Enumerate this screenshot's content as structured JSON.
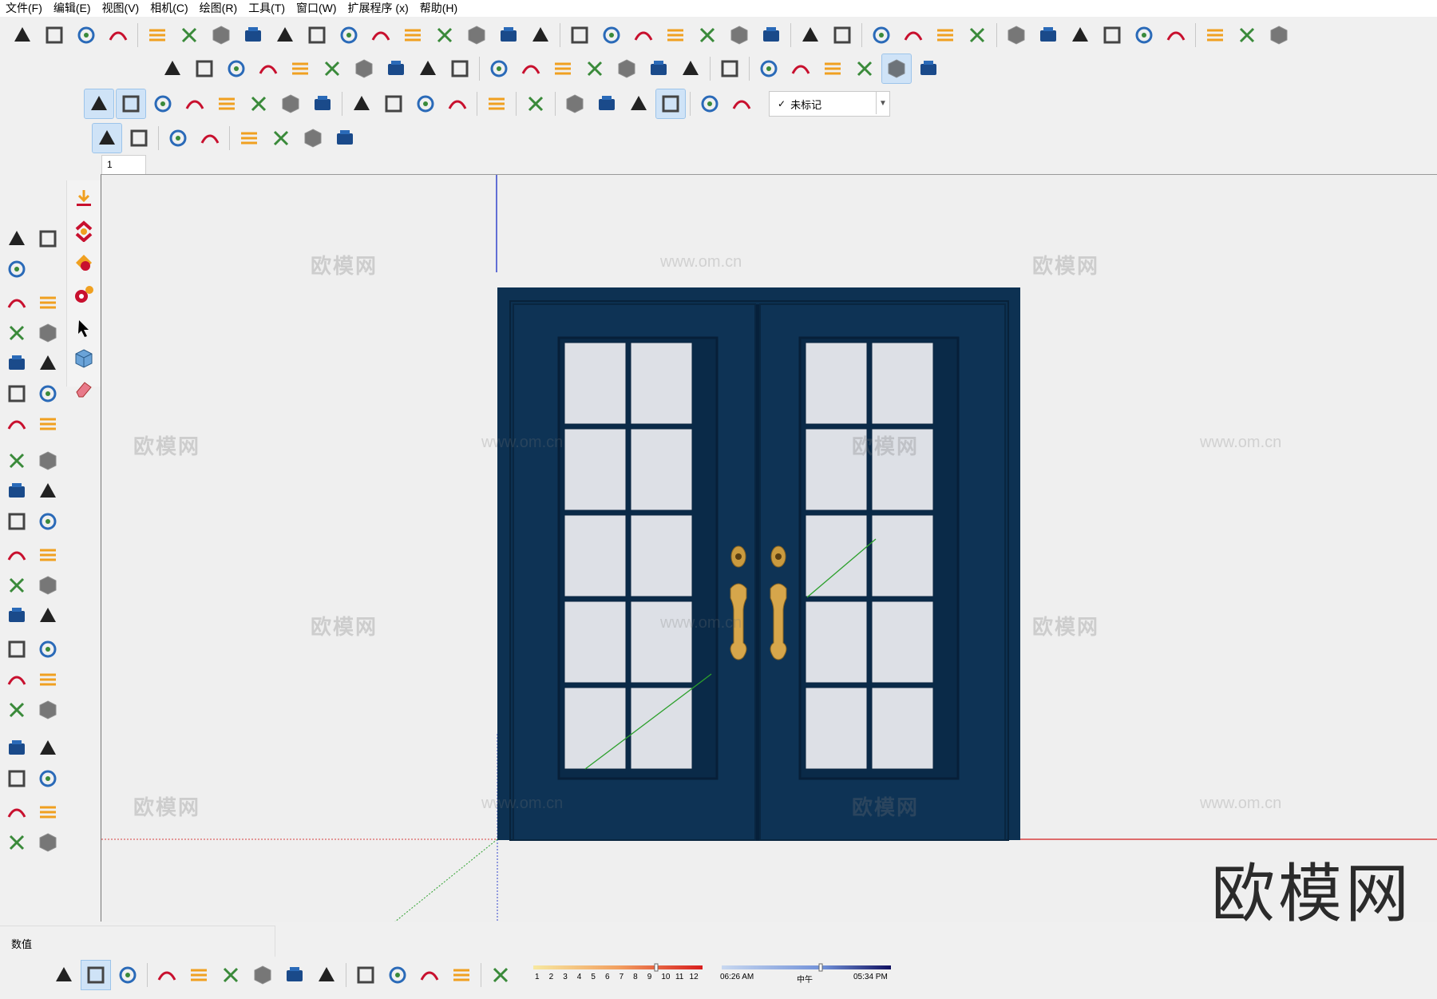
{
  "menu": [
    "文件(F)",
    "编辑(E)",
    "视图(V)",
    "相机(C)",
    "绘图(R)",
    "工具(T)",
    "窗口(W)",
    "扩展程序 (x)",
    "帮助(H)"
  ],
  "tag_selector": {
    "value": "未标记",
    "check": "✓"
  },
  "scene_tab": {
    "label": "1"
  },
  "measurements": {
    "label": "数值"
  },
  "shadow": {
    "months": [
      "1",
      "2",
      "3",
      "4",
      "5",
      "6",
      "7",
      "8",
      "9",
      "10",
      "11",
      "12"
    ],
    "time_start": "06:26 AM",
    "noon": "中午",
    "time_end": "05:34 PM"
  },
  "watermark": {
    "site": "欧模网",
    "url": "www.om.cn"
  },
  "colors": {
    "door": "#0d3152",
    "door_frame": "#0b2a47",
    "glass": "#dde0e6",
    "handle": "#d6a64b",
    "axis_red": "#d94040",
    "axis_green": "#2ca02c",
    "axis_blue": "#3344cc"
  },
  "icons": {
    "row1": [
      "sandbox-from-contours-icon",
      "sandbox-from-scratch-icon",
      "smoove-icon",
      "stamp-icon",
      "drape-icon",
      "add-detail-icon",
      "flip-edge-icon",
      "curve-tool-icon",
      "bezier-icon",
      "spiral-icon",
      "loft-icon",
      "extrude-edges-icon",
      "shell-icon",
      "joint-push-pull-icon",
      "round-corner-icon",
      "stairs-icon",
      "bridge-icon",
      "follow-me-icon",
      "solar-north-icon",
      "offset-icon",
      "array-icon",
      "mirror-icon",
      "dots-icon",
      "block-icon",
      "pen-icon",
      "brush-icon",
      "render-icon",
      "render-settings-icon",
      "import-icon",
      "checkbox-icon",
      "cloud-icon",
      "component-icon",
      "refresh-icon",
      "house-3d-icon",
      "door-book-icon",
      "house-icon",
      "house-outline-icon",
      "storefront-icon",
      "roof-icon"
    ],
    "row2": [
      "ruler-icon",
      "dimension-icon",
      "select-pick-icon",
      "wedge-icon",
      "box-icon",
      "cylinder-icon",
      "panel-icon",
      "arrow-icon",
      "cut-icon",
      "wave-icon",
      "window-icon",
      "window-refresh-icon",
      "layer-stack-icon",
      "layer-stack2-icon",
      "layer-stack3-icon",
      "layer-stack4-icon",
      "layer-stack5-icon",
      "layer-blue-icon",
      "cube-outline-icon",
      "cube-wire-icon",
      "cube-white-icon",
      "cube-shaded-icon",
      "cube-dark-icon",
      "cube-blue-icon"
    ],
    "row3": [
      "play-icon",
      "pause-icon",
      "record-icon",
      "stop-icon",
      "settings-icon",
      "film-icon",
      "render-frame-icon",
      "help-icon",
      "sun-dot-icon",
      "spotlight-icon",
      "line-icon",
      "rectangle-icon",
      "hide-icon",
      "pin-icon",
      "refresh-gray-icon",
      "camera-video-icon",
      "camera-icon",
      "clock-eye-icon",
      "flower-icon",
      "box-arrow-icon"
    ],
    "row4": [
      "cloud-wave-icon",
      "cloud-link-icon",
      "cloud-sync-icon",
      "cloud-list-icon",
      "resize-icon",
      "dots-circle-icon",
      "refresh-circle-icon",
      "chrome-icon"
    ],
    "left": [
      "select-icon",
      "component-icon",
      "eraser-icon",
      "pencil-icon",
      "freehand-icon",
      "rectangle-icon",
      "rotated-rect-icon",
      "circle-icon",
      "polygon-icon",
      "arc-icon",
      "two-point-arc-icon",
      "three-point-arc-icon",
      "pie-icon",
      "move-icon",
      "push-pull-icon",
      "rotate-icon",
      "follow-me-icon",
      "scale-icon",
      "offset-icon",
      "tape-measure-icon",
      "dimension-icon",
      "protractor-icon",
      "text-icon",
      "axes-icon",
      "3d-text-icon",
      "orbit-icon",
      "pan-icon",
      "zoom-icon",
      "zoom-window-icon",
      "zoom-extents-icon",
      "previous-view-icon",
      "position-camera-icon",
      "look-around-icon",
      "walk-icon",
      "section-plane-icon",
      "warehouse-icon",
      "extension-icon",
      "layers-icon",
      "extension-settings-icon"
    ],
    "status": [
      "geo-location-icon",
      "credits-icon",
      "swap-icon",
      "add-icon",
      "shield-icon",
      "chart-icon",
      "checker-icon",
      "cloud-upload-icon",
      "gear-icon",
      "chat-icon",
      "info-icon",
      "cart-icon",
      "user-icon",
      "eraser-icon"
    ]
  }
}
